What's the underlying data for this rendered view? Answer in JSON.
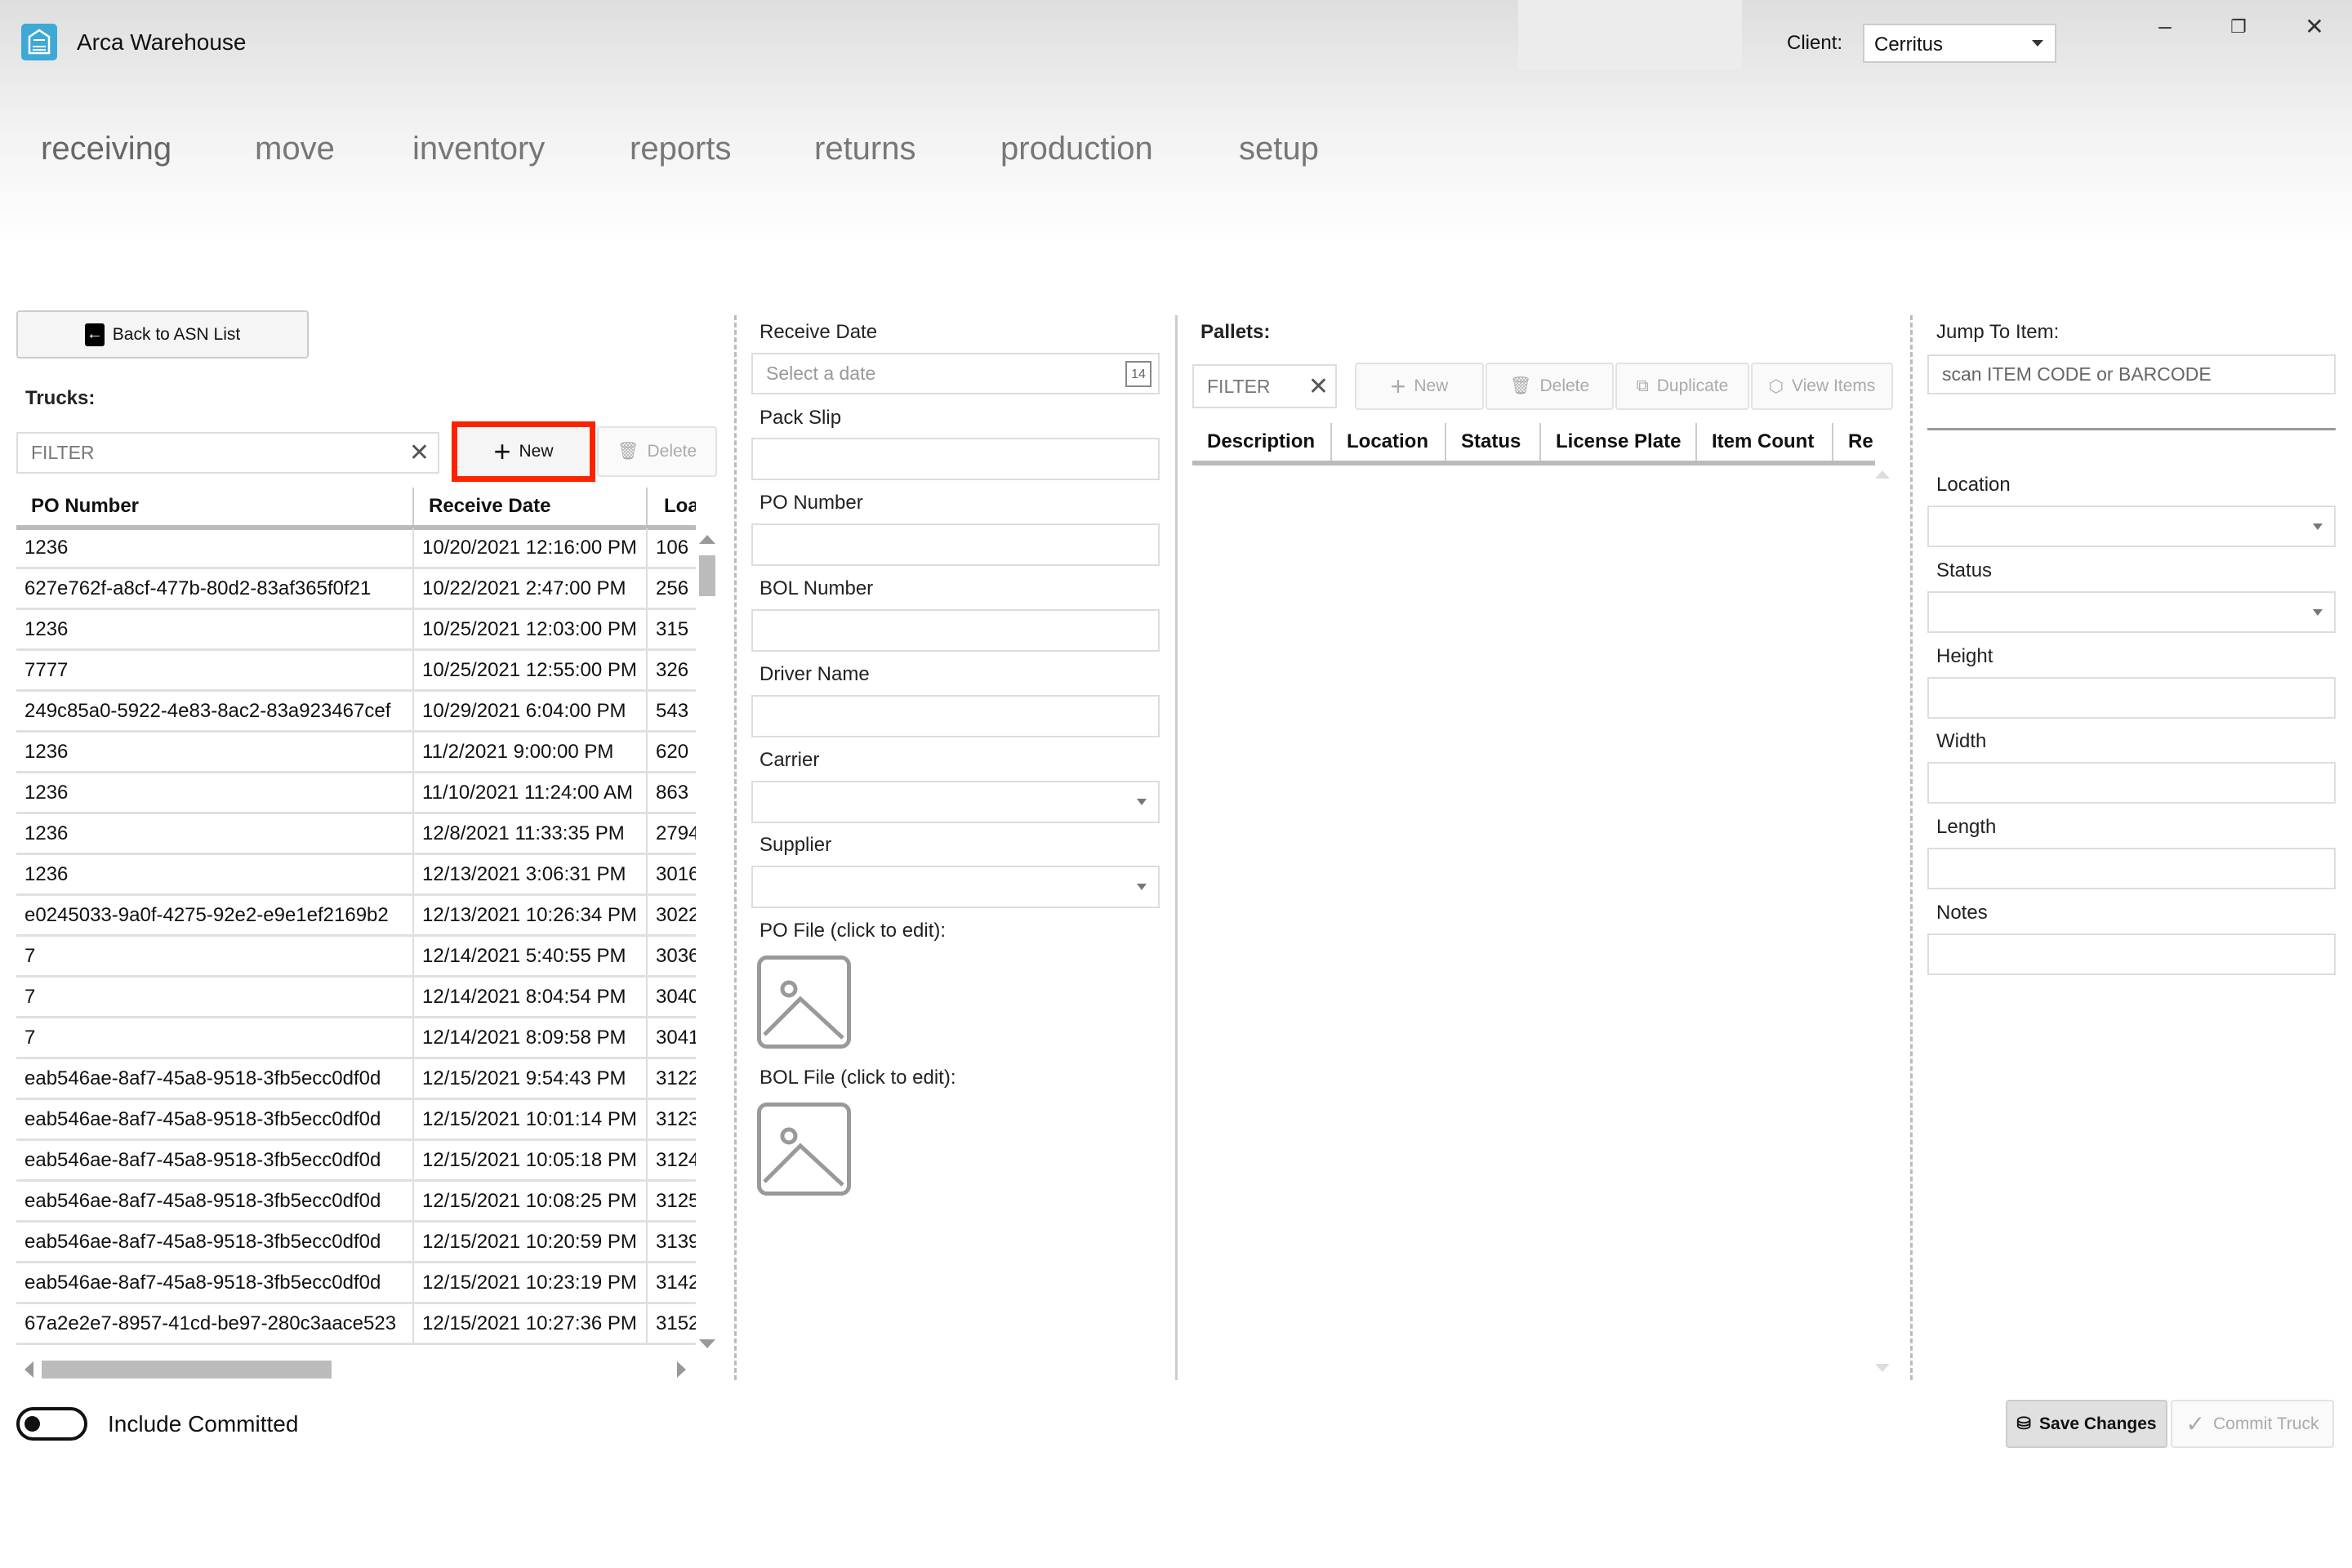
{
  "app": {
    "title": "Arca Warehouse",
    "client_label": "Client:",
    "client_value": "Cerritus",
    "window": {
      "minimize": "–",
      "restore": "❐",
      "close": "✕"
    }
  },
  "nav": [
    "receiving",
    "move",
    "inventory",
    "reports",
    "returns",
    "production",
    "setup"
  ],
  "nav_active": "receiving",
  "trucks": {
    "back_label": "Back to ASN List",
    "title": "Trucks:",
    "filter_placeholder": "FILTER",
    "new_label": "New",
    "delete_label": "Delete",
    "columns": [
      "PO Number",
      "Receive Date",
      "Loa"
    ],
    "rows": [
      [
        "1236",
        "10/20/2021 12:16:00 PM",
        "106"
      ],
      [
        "627e762f-a8cf-477b-80d2-83af365f0f21",
        "10/22/2021 2:47:00 PM",
        "256"
      ],
      [
        "1236",
        "10/25/2021 12:03:00 PM",
        "315"
      ],
      [
        "7777",
        "10/25/2021 12:55:00 PM",
        "326"
      ],
      [
        "249c85a0-5922-4e83-8ac2-83a923467cef",
        "10/29/2021 6:04:00 PM",
        "543"
      ],
      [
        "1236",
        "11/2/2021 9:00:00 PM",
        "620"
      ],
      [
        "1236",
        "11/10/2021 11:24:00 AM",
        "863"
      ],
      [
        "1236",
        "12/8/2021 11:33:35 PM",
        "2794"
      ],
      [
        "1236",
        "12/13/2021 3:06:31 PM",
        "3016"
      ],
      [
        "e0245033-9a0f-4275-92e2-e9e1ef2169b2",
        "12/13/2021 10:26:34 PM",
        "3022"
      ],
      [
        "7",
        "12/14/2021 5:40:55 PM",
        "3036"
      ],
      [
        "7",
        "12/14/2021 8:04:54 PM",
        "3040"
      ],
      [
        "7",
        "12/14/2021 8:09:58 PM",
        "3041"
      ],
      [
        "eab546ae-8af7-45a8-9518-3fb5ecc0df0d",
        "12/15/2021 9:54:43 PM",
        "3122"
      ],
      [
        "eab546ae-8af7-45a8-9518-3fb5ecc0df0d",
        "12/15/2021 10:01:14 PM",
        "3123"
      ],
      [
        "eab546ae-8af7-45a8-9518-3fb5ecc0df0d",
        "12/15/2021 10:05:18 PM",
        "3124"
      ],
      [
        "eab546ae-8af7-45a8-9518-3fb5ecc0df0d",
        "12/15/2021 10:08:25 PM",
        "3125"
      ],
      [
        "eab546ae-8af7-45a8-9518-3fb5ecc0df0d",
        "12/15/2021 10:20:59 PM",
        "3139"
      ],
      [
        "eab546ae-8af7-45a8-9518-3fb5ecc0df0d",
        "12/15/2021 10:23:19 PM",
        "3142"
      ],
      [
        "67a2e2e7-8957-41cd-be97-280c3aace523",
        "12/15/2021 10:27:36 PM",
        "3152"
      ]
    ],
    "include_committed_label": "Include Committed",
    "include_committed": false
  },
  "form": {
    "receive_date_label": "Receive Date",
    "receive_date_placeholder": "Select a date",
    "calendar_day": "14",
    "pack_slip_label": "Pack Slip",
    "pack_slip": "",
    "po_number_label": "PO Number",
    "po_number": "",
    "bol_number_label": "BOL Number",
    "bol_number": "",
    "driver_name_label": "Driver Name",
    "driver_name": "",
    "carrier_label": "Carrier",
    "carrier": "",
    "supplier_label": "Supplier",
    "supplier": "",
    "po_file_label": "PO File (click to edit):",
    "bol_file_label": "BOL File (click to edit):"
  },
  "pallets": {
    "title": "Pallets:",
    "filter_placeholder": "FILTER",
    "new_label": "New",
    "delete_label": "Delete",
    "duplicate_label": "Duplicate",
    "view_items_label": "View Items",
    "columns": [
      "Description",
      "Location",
      "Status",
      "License Plate",
      "Item Count",
      "Re"
    ],
    "rows": []
  },
  "item": {
    "jump_label": "Jump To Item:",
    "jump_placeholder": "scan ITEM CODE or BARCODE",
    "location_label": "Location",
    "status_label": "Status",
    "height_label": "Height",
    "width_label": "Width",
    "length_label": "Length",
    "notes_label": "Notes"
  },
  "actions": {
    "save_label": "Save Changes",
    "commit_label": "Commit Truck"
  },
  "colors": {
    "brand": "#3fa9d6",
    "highlight": "#ff2200"
  }
}
